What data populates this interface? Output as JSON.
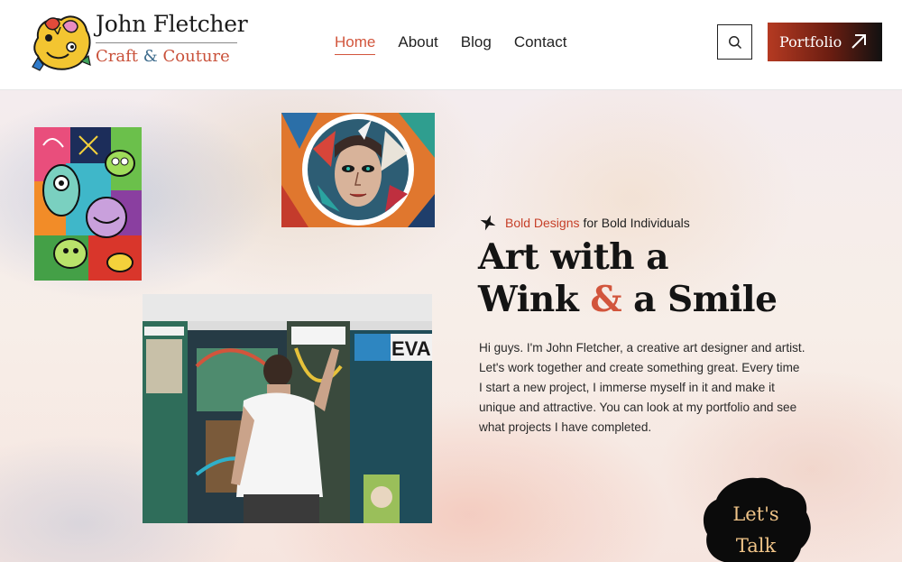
{
  "brand": {
    "name": "John Fletcher",
    "tagline_part1": "Craft ",
    "tagline_amp": "&",
    "tagline_part2": " Couture"
  },
  "nav": {
    "items": [
      {
        "label": "Home",
        "active": true
      },
      {
        "label": "About"
      },
      {
        "label": "Blog"
      },
      {
        "label": "Contact"
      }
    ]
  },
  "header": {
    "search_icon": "search-icon",
    "portfolio_label": "Portfolio",
    "portfolio_icon": "arrow-up-right-icon"
  },
  "hero": {
    "eyebrow_accent": "Bold Designs",
    "eyebrow_rest": "for Bold Individuals",
    "headline_line1": "Art with a",
    "headline_line2_a": "Wink ",
    "headline_amp": "&",
    "headline_line2_b": " a Smile",
    "bio_line1": "Hi guys. I'm John Fletcher, a creative art designer and artist.",
    "bio_line2": "Let's work together and create something great. Every time",
    "bio_line3": "I start a new project, I immerse myself in it and make it",
    "bio_line4": "unique and attractive. You can look at my portfolio and see",
    "bio_line5": "what projects I have completed."
  },
  "cta": {
    "talk_line1": "Let's",
    "talk_line2": "Talk"
  },
  "colors": {
    "accent": "#d2553c",
    "portfolio_gradient_start": "#b53a22",
    "portfolio_gradient_end": "#111111",
    "talk_text": "#f0c488"
  }
}
